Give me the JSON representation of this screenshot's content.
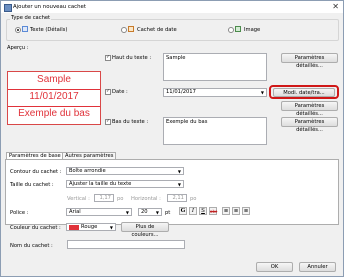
{
  "window": {
    "title": "Ajouter un nouveau cachet",
    "close_glyph": "✕"
  },
  "stamp_type": {
    "group_label": "Type de cachet",
    "options": [
      {
        "label": "Texte (Détails)",
        "selected": true
      },
      {
        "label": "Cachet de date",
        "selected": false
      },
      {
        "label": "Image",
        "selected": false
      }
    ]
  },
  "preview": {
    "label": "Aperçu :",
    "lines": [
      "Sample",
      "11/01/2017",
      "Exemple du bas"
    ],
    "color": "#e0323a"
  },
  "top_text": {
    "label": "Haut du texte :",
    "checked": true,
    "value": "Sample",
    "details_button": "Paramètres détaillés..."
  },
  "date": {
    "label": "Date :",
    "checked": true,
    "value": "11/01/2017",
    "modify_button": "Modi. date/tra...",
    "details_button": "Paramètres détaillés..."
  },
  "bottom_text": {
    "label": "Bas du texte :",
    "checked": true,
    "value": "Exemple du bas",
    "details_button": "Paramètres détaillés..."
  },
  "tabs": [
    {
      "label": "Paramètres de base",
      "active": true
    },
    {
      "label": "Autres paramètres",
      "active": false
    }
  ],
  "basic": {
    "outline_label": "Contour du cachet :",
    "outline_value": "Boîte arrondie",
    "size_label": "Taille du cachet :",
    "size_value": "Ajuster la taille du texte",
    "vertical_label": "Vertical :",
    "vertical_value": "1,17",
    "vertical_unit": "po",
    "horizontal_label": "Horizontal :",
    "horizontal_value": "2,11",
    "horizontal_unit": "po",
    "font_label": "Police :",
    "font_value": "Arial",
    "font_size": "20",
    "font_size_unit": "pt",
    "color_label": "Couleur du cachet :",
    "color_value": "Rouge",
    "color_swatch": "#e0323a",
    "more_colors_button": "Plus de couleurs..."
  },
  "stamp_name": {
    "label": "Nom du cachet :",
    "value": ""
  },
  "footer": {
    "ok": "OK",
    "cancel": "Annuler"
  },
  "accent": {
    "highlight": "#d01818"
  }
}
